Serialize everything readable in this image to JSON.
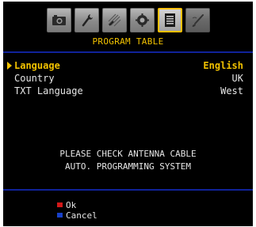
{
  "header": {
    "icons": [
      "camera-icon",
      "wrench-icon",
      "picture-settings-icon",
      "gear-icon",
      "program-table-icon",
      "paintbrush-icon"
    ],
    "selected_index": 4,
    "title": "PROGRAM TABLE"
  },
  "menu": {
    "items": [
      {
        "label": "Language",
        "value": "English",
        "selected": true
      },
      {
        "label": "Country",
        "value": "UK",
        "selected": false
      },
      {
        "label": "TXT Language",
        "value": "West",
        "selected": false
      }
    ]
  },
  "messages": {
    "line1": "PLEASE CHECK ANTENNA CABLE",
    "line2": "AUTO. PROGRAMMING SYSTEM"
  },
  "legend": {
    "ok": {
      "label": "Ok",
      "color": "#d21818"
    },
    "cancel": {
      "label": "Cancel",
      "color": "#1840c8"
    }
  },
  "colors": {
    "accent": "#f2c200",
    "divider": "#10229a",
    "background": "#000000"
  }
}
